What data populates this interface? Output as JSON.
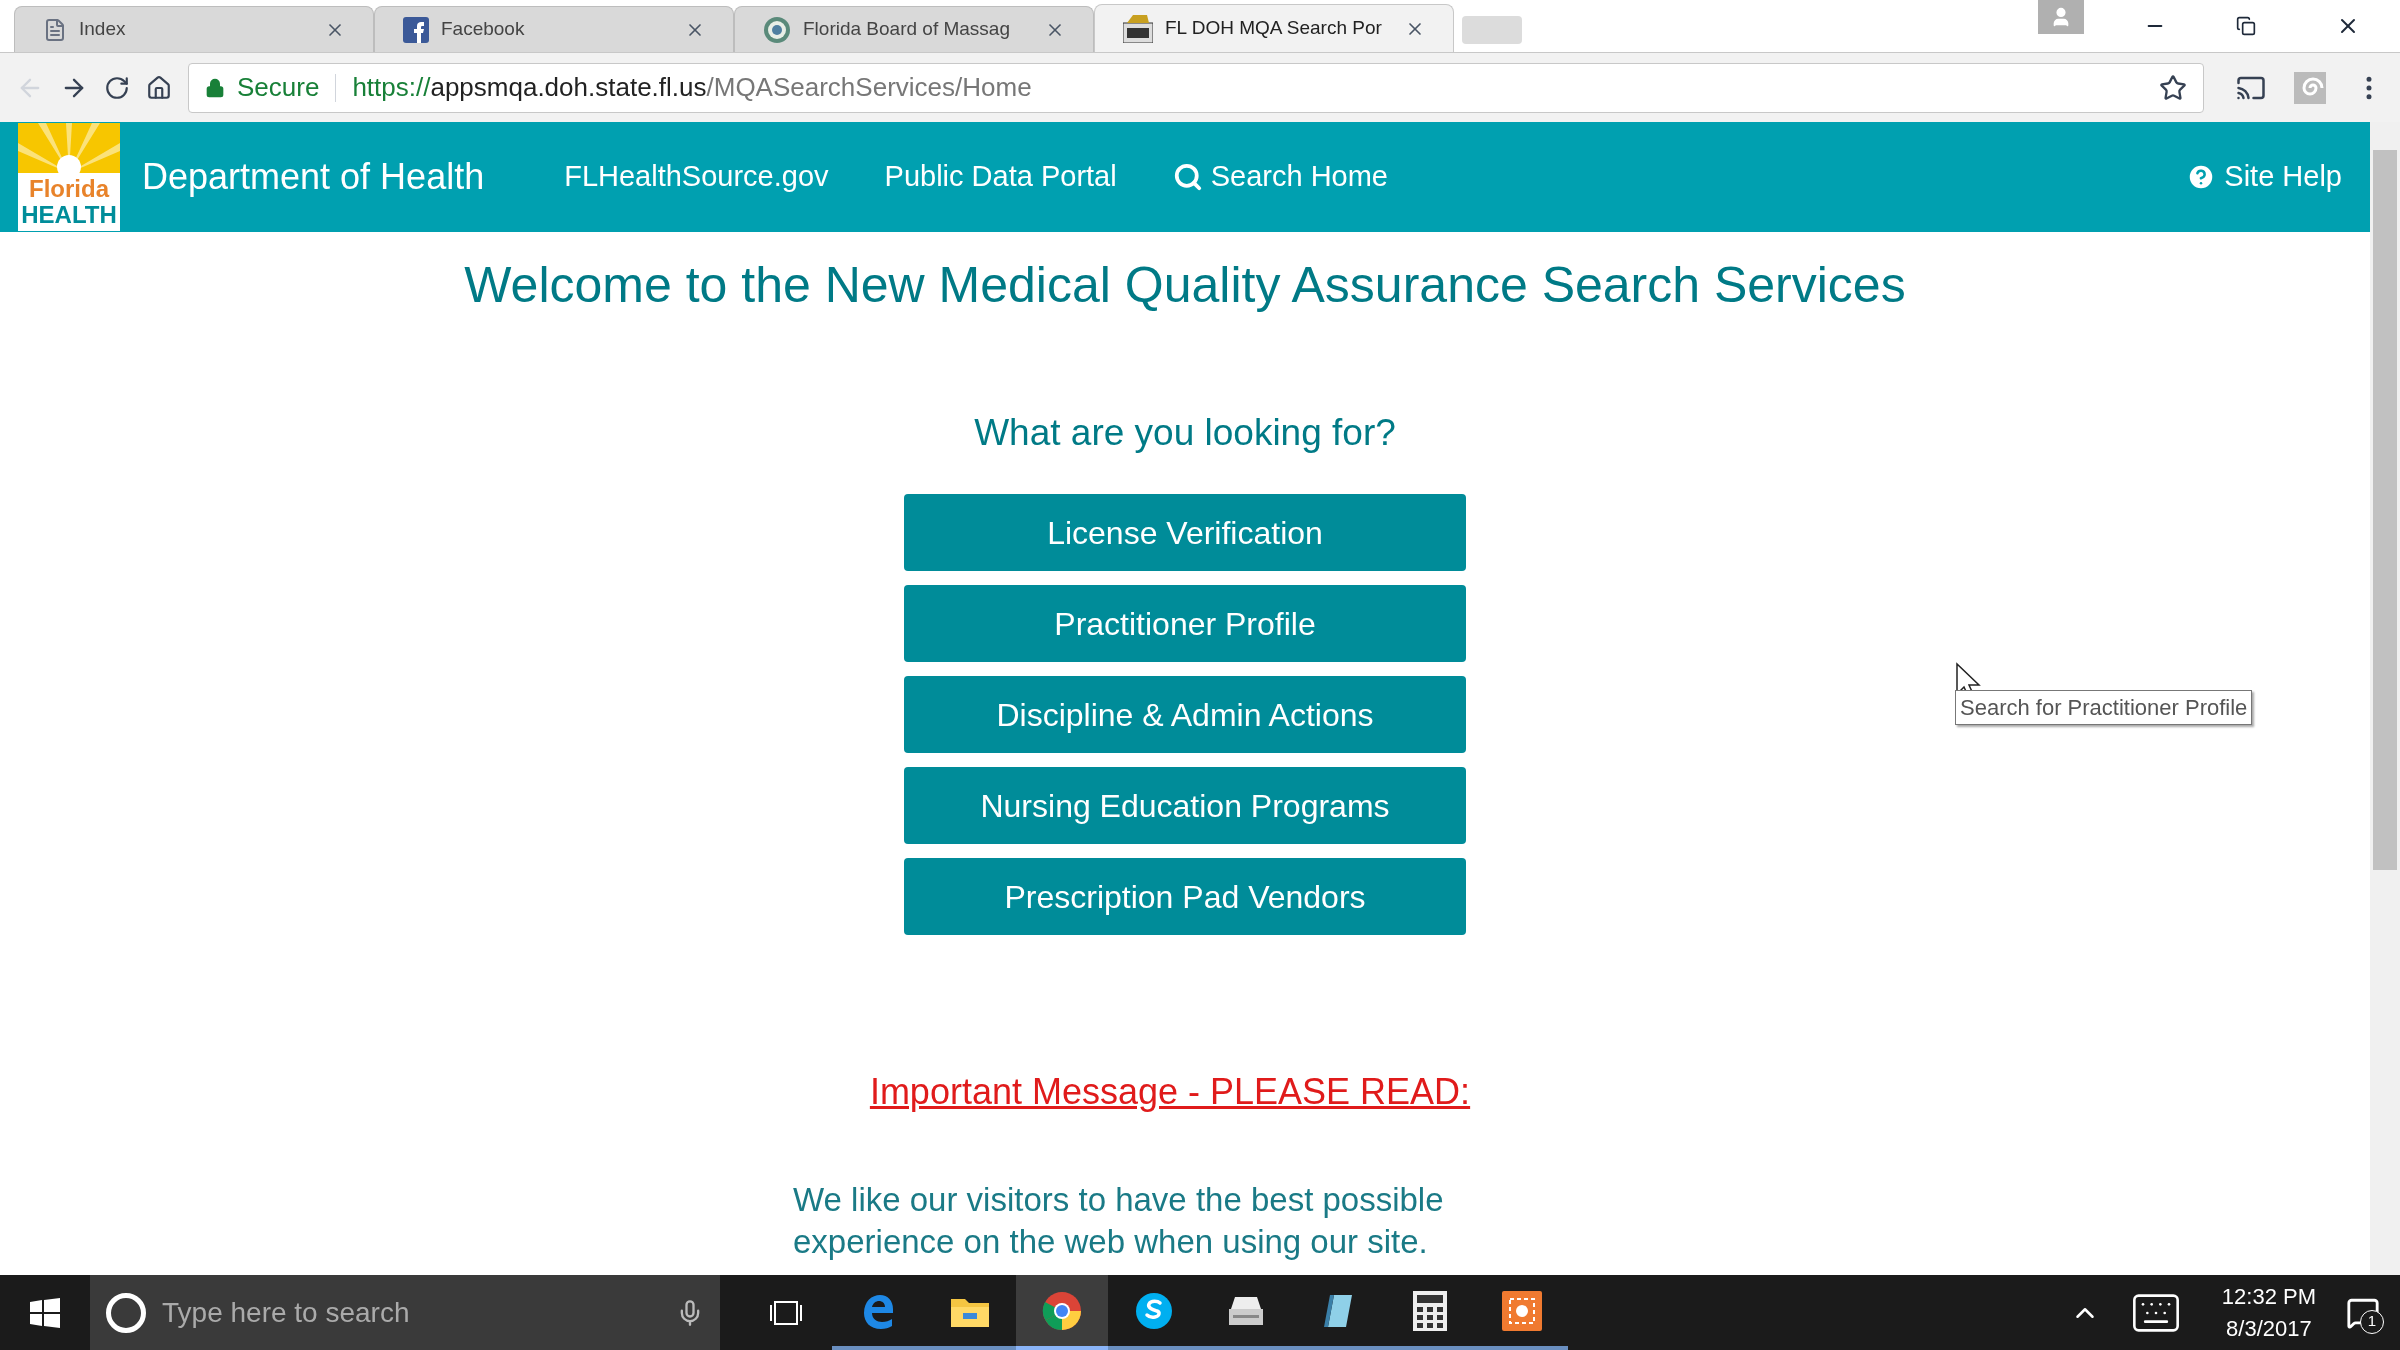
{
  "browser": {
    "tabs": [
      {
        "title": "Index",
        "kind": "page",
        "selected": false
      },
      {
        "title": "Facebook",
        "kind": "facebook",
        "selected": false
      },
      {
        "title": "Florida Board of Massag",
        "kind": "seal",
        "selected": false
      },
      {
        "title": "FL DOH MQA Search Por",
        "kind": "doh",
        "selected": true
      }
    ],
    "address": {
      "secure_label": "Secure",
      "scheme": "https://",
      "host": "appsmqa.doh.state.fl.us",
      "path": "/MQASearchServices/Home"
    }
  },
  "header": {
    "logo_top": "Florida",
    "logo_bottom": "HEALTH",
    "brand": "Department of Health",
    "nav": [
      {
        "label": "FLHealthSource.gov",
        "kind": "link"
      },
      {
        "label": "Public Data Portal",
        "kind": "link"
      },
      {
        "label": "Search Home",
        "kind": "search"
      }
    ],
    "help": "Site Help"
  },
  "page": {
    "title": "Welcome to the New Medical Quality Assurance Search Services",
    "question": "What are you looking for?",
    "buttons": [
      "License Verification",
      "Practitioner Profile",
      "Discipline & Admin Actions",
      "Nursing Education Programs",
      "Prescription Pad Vendors"
    ],
    "important": "Important Message - PLEASE READ:",
    "paragraph": "We like our visitors to have the best possible experience on the web when using our site."
  },
  "tooltip": "Search for Practitioner Profile",
  "taskbar": {
    "search_placeholder": "Type here to search",
    "apps": [
      {
        "kind": "taskview",
        "selected": false
      },
      {
        "kind": "edge",
        "selected": false
      },
      {
        "kind": "explorer",
        "selected": false
      },
      {
        "kind": "chrome",
        "selected": true
      },
      {
        "kind": "skype",
        "selected": false
      },
      {
        "kind": "scanner",
        "selected": false
      },
      {
        "kind": "notepad",
        "selected": false
      },
      {
        "kind": "calculator",
        "selected": false
      },
      {
        "kind": "capture",
        "selected": false
      }
    ],
    "time": "12:32 PM",
    "date": "8/3/2017",
    "notifications": "1"
  }
}
